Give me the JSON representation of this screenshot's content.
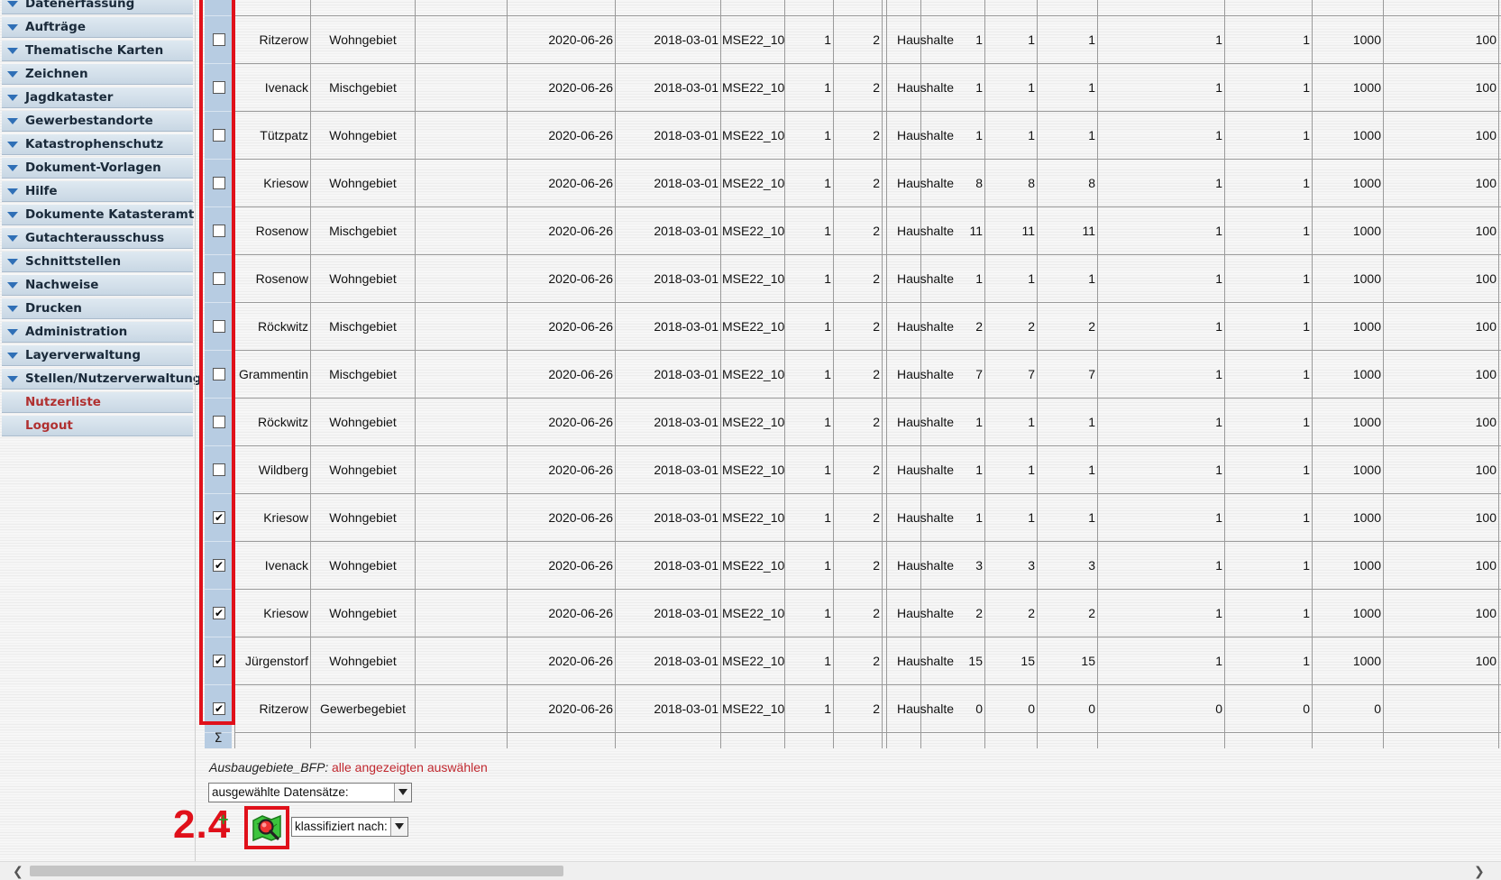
{
  "sidebar": {
    "items": [
      {
        "label": "Datenerfassung",
        "type": "group"
      },
      {
        "label": "Aufträge",
        "type": "group"
      },
      {
        "label": "Thematische Karten",
        "type": "group"
      },
      {
        "label": "Zeichnen",
        "type": "group"
      },
      {
        "label": "Jagdkataster",
        "type": "group"
      },
      {
        "label": "Gewerbestandorte",
        "type": "group"
      },
      {
        "label": "Katastrophenschutz",
        "type": "group"
      },
      {
        "label": "Dokument-Vorlagen",
        "type": "group"
      },
      {
        "label": "Hilfe",
        "type": "group"
      },
      {
        "label": "Dokumente Katasteramt",
        "type": "group"
      },
      {
        "label": "Gutachterausschuss",
        "type": "group"
      },
      {
        "label": "Schnittstellen",
        "type": "group"
      },
      {
        "label": "Nachweise",
        "type": "group"
      },
      {
        "label": "Drucken",
        "type": "group"
      },
      {
        "label": "Administration",
        "type": "group"
      },
      {
        "label": "Layerverwaltung",
        "type": "group"
      },
      {
        "label": "Stellen/Nutzerverwaltung",
        "type": "group"
      },
      {
        "label": "Nutzerliste",
        "type": "link"
      },
      {
        "label": "Logout",
        "type": "link"
      }
    ]
  },
  "table": {
    "rows": [
      {
        "checked": false,
        "ort": "Ritzerow",
        "gebiet": "Wohngebiet",
        "datum1": "2020-06-26",
        "datum2": "2018-03-01",
        "code": "MSE22_10",
        "n1": "1",
        "n2": "2",
        "kategorie": "Haushalte",
        "v1": "1",
        "v2": "1",
        "v3": "1",
        "v4": "1",
        "v5": "1",
        "v6": "1000",
        "v7": "100"
      },
      {
        "checked": false,
        "ort": "Ivenack",
        "gebiet": "Mischgebiet",
        "datum1": "2020-06-26",
        "datum2": "2018-03-01",
        "code": "MSE22_10",
        "n1": "1",
        "n2": "2",
        "kategorie": "Haushalte",
        "v1": "1",
        "v2": "1",
        "v3": "1",
        "v4": "1",
        "v5": "1",
        "v6": "1000",
        "v7": "100"
      },
      {
        "checked": false,
        "ort": "Tützpatz",
        "gebiet": "Wohngebiet",
        "datum1": "2020-06-26",
        "datum2": "2018-03-01",
        "code": "MSE22_10",
        "n1": "1",
        "n2": "2",
        "kategorie": "Haushalte",
        "v1": "1",
        "v2": "1",
        "v3": "1",
        "v4": "1",
        "v5": "1",
        "v6": "1000",
        "v7": "100"
      },
      {
        "checked": false,
        "ort": "Kriesow",
        "gebiet": "Wohngebiet",
        "datum1": "2020-06-26",
        "datum2": "2018-03-01",
        "code": "MSE22_10",
        "n1": "1",
        "n2": "2",
        "kategorie": "Haushalte",
        "v1": "8",
        "v2": "8",
        "v3": "8",
        "v4": "1",
        "v5": "1",
        "v6": "1000",
        "v7": "100"
      },
      {
        "checked": false,
        "ort": "Rosenow",
        "gebiet": "Mischgebiet",
        "datum1": "2020-06-26",
        "datum2": "2018-03-01",
        "code": "MSE22_10",
        "n1": "1",
        "n2": "2",
        "kategorie": "Haushalte",
        "v1": "11",
        "v2": "11",
        "v3": "11",
        "v4": "1",
        "v5": "1",
        "v6": "1000",
        "v7": "100"
      },
      {
        "checked": false,
        "ort": "Rosenow",
        "gebiet": "Wohngebiet",
        "datum1": "2020-06-26",
        "datum2": "2018-03-01",
        "code": "MSE22_10",
        "n1": "1",
        "n2": "2",
        "kategorie": "Haushalte",
        "v1": "1",
        "v2": "1",
        "v3": "1",
        "v4": "1",
        "v5": "1",
        "v6": "1000",
        "v7": "100"
      },
      {
        "checked": false,
        "ort": "Röckwitz",
        "gebiet": "Mischgebiet",
        "datum1": "2020-06-26",
        "datum2": "2018-03-01",
        "code": "MSE22_10",
        "n1": "1",
        "n2": "2",
        "kategorie": "Haushalte",
        "v1": "2",
        "v2": "2",
        "v3": "2",
        "v4": "1",
        "v5": "1",
        "v6": "1000",
        "v7": "100"
      },
      {
        "checked": false,
        "ort": "Grammentin",
        "gebiet": "Mischgebiet",
        "datum1": "2020-06-26",
        "datum2": "2018-03-01",
        "code": "MSE22_10",
        "n1": "1",
        "n2": "2",
        "kategorie": "Haushalte",
        "v1": "7",
        "v2": "7",
        "v3": "7",
        "v4": "1",
        "v5": "1",
        "v6": "1000",
        "v7": "100"
      },
      {
        "checked": false,
        "ort": "Röckwitz",
        "gebiet": "Wohngebiet",
        "datum1": "2020-06-26",
        "datum2": "2018-03-01",
        "code": "MSE22_10",
        "n1": "1",
        "n2": "2",
        "kategorie": "Haushalte",
        "v1": "1",
        "v2": "1",
        "v3": "1",
        "v4": "1",
        "v5": "1",
        "v6": "1000",
        "v7": "100"
      },
      {
        "checked": false,
        "ort": "Wildberg",
        "gebiet": "Wohngebiet",
        "datum1": "2020-06-26",
        "datum2": "2018-03-01",
        "code": "MSE22_10",
        "n1": "1",
        "n2": "2",
        "kategorie": "Haushalte",
        "v1": "1",
        "v2": "1",
        "v3": "1",
        "v4": "1",
        "v5": "1",
        "v6": "1000",
        "v7": "100"
      },
      {
        "checked": true,
        "ort": "Kriesow",
        "gebiet": "Wohngebiet",
        "datum1": "2020-06-26",
        "datum2": "2018-03-01",
        "code": "MSE22_10",
        "n1": "1",
        "n2": "2",
        "kategorie": "Haushalte",
        "v1": "1",
        "v2": "1",
        "v3": "1",
        "v4": "1",
        "v5": "1",
        "v6": "1000",
        "v7": "100"
      },
      {
        "checked": true,
        "ort": "Ivenack",
        "gebiet": "Wohngebiet",
        "datum1": "2020-06-26",
        "datum2": "2018-03-01",
        "code": "MSE22_10",
        "n1": "1",
        "n2": "2",
        "kategorie": "Haushalte",
        "v1": "3",
        "v2": "3",
        "v3": "3",
        "v4": "1",
        "v5": "1",
        "v6": "1000",
        "v7": "100"
      },
      {
        "checked": true,
        "ort": "Kriesow",
        "gebiet": "Wohngebiet",
        "datum1": "2020-06-26",
        "datum2": "2018-03-01",
        "code": "MSE22_10",
        "n1": "1",
        "n2": "2",
        "kategorie": "Haushalte",
        "v1": "2",
        "v2": "2",
        "v3": "2",
        "v4": "1",
        "v5": "1",
        "v6": "1000",
        "v7": "100"
      },
      {
        "checked": true,
        "ort": "Jürgenstorf",
        "gebiet": "Wohngebiet",
        "datum1": "2020-06-26",
        "datum2": "2018-03-01",
        "code": "MSE22_10",
        "n1": "1",
        "n2": "2",
        "kategorie": "Haushalte",
        "v1": "15",
        "v2": "15",
        "v3": "15",
        "v4": "1",
        "v5": "1",
        "v6": "1000",
        "v7": "100"
      },
      {
        "checked": true,
        "ort": "Ritzerow",
        "gebiet": "Gewerbegebiet",
        "datum1": "2020-06-26",
        "datum2": "2018-03-01",
        "code": "MSE22_10",
        "n1": "1",
        "n2": "2",
        "kategorie": "Haushalte",
        "v1": "0",
        "v2": "0",
        "v3": "0",
        "v4": "0",
        "v5": "0",
        "v6": "0",
        "v7": ""
      }
    ],
    "sum_symbol": "Σ"
  },
  "footer": {
    "layer_name": "Ausbaugebiete_BFP:",
    "select_all_link": "alle angezeigten auswählen",
    "records_select": "ausgewählte Datensätze:",
    "classify_select": "klassifiziert nach:",
    "annotation_step": "2.4"
  },
  "colors": {
    "annotation": "#e0101a",
    "link": "#c0282f",
    "checkbox_column": "#b7cce2"
  },
  "icons": {
    "menu_group": "triangle-down-icon",
    "search_map": "map-search-icon",
    "scroll_left": "chevron-left-icon",
    "scroll_right": "chevron-right-icon"
  }
}
